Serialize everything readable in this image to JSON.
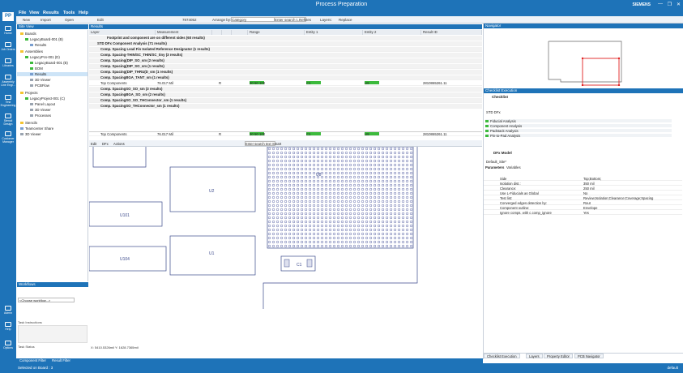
{
  "app": {
    "title": "Process Preparation",
    "brand": "SIEMENS",
    "logo": "PP",
    "window_controls": [
      "—",
      "❐",
      "✕"
    ]
  },
  "menu": [
    "File",
    "View",
    "Results",
    "Tools",
    "Help"
  ],
  "left_nav": [
    {
      "label": "Home",
      "icon": "home-icon"
    },
    {
      "label": "Job Orders",
      "icon": "job-orders-icon"
    },
    {
      "label": "Libraries",
      "icon": "libraries-icon"
    },
    {
      "label": "Assembly Line Engi...",
      "icon": "assembly-icon"
    },
    {
      "label": "Test Engineering",
      "icon": "test-icon"
    },
    {
      "label": "Stencil Design",
      "icon": "stencil-icon"
    },
    {
      "label": "Customer Manager",
      "icon": "customer-icon"
    },
    {
      "label": "Admin",
      "icon": "admin-icon"
    },
    {
      "label": "Help",
      "icon": "help-icon"
    },
    {
      "label": "Options",
      "icon": "options-icon"
    }
  ],
  "toolbar": {
    "new": "New",
    "import": "Import",
    "open": "Open",
    "edit": "Edit",
    "zoom": "7874052",
    "arrange_by": "Arrange by:",
    "arrange_value": "Category",
    "enter_search": "Enter search t...",
    "refdes": "RefDes",
    "layers": "Layers:",
    "layers_value": "Replace"
  },
  "site_view": {
    "title": "Site View",
    "items": [
      {
        "label": "Boards",
        "level": 0
      },
      {
        "label": "LegacyBoard-001 (B)",
        "level": 1
      },
      {
        "label": "Results",
        "level": 2
      },
      {
        "label": "Assemblies",
        "level": 0
      },
      {
        "label": "LegacyPcs-001 (D)",
        "level": 1
      },
      {
        "label": "LegacyBoard-001 (B)",
        "level": 2
      },
      {
        "label": "BOM",
        "level": 2
      },
      {
        "label": "Results",
        "level": 2,
        "selected": true
      },
      {
        "label": "3D Viewer",
        "level": 2
      },
      {
        "label": "PCBFlow",
        "level": 2
      },
      {
        "label": "Projects",
        "level": 0
      },
      {
        "label": "LegacyProject-001 (C)",
        "level": 1
      },
      {
        "label": "Panel Layout",
        "level": 2
      },
      {
        "label": "3D Viewer",
        "level": 2
      },
      {
        "label": "Processes",
        "level": 2
      },
      {
        "label": "Stencils",
        "level": 0
      },
      {
        "label": "Teamcenter Share",
        "level": 0
      },
      {
        "label": "3D Viewer",
        "level": 0
      }
    ]
  },
  "results": {
    "title": "Results",
    "columns": [
      "Layer",
      "Measurement",
      "",
      "",
      "",
      "Range",
      "Entity 1",
      "Entity 2",
      "Result ID"
    ],
    "rows": [
      {
        "type": "group",
        "text": "Footprint and component are on different sides (60 results)"
      },
      {
        "type": "group",
        "text": "STD DFx Component Analysis (71 results)"
      },
      {
        "type": "group",
        "text": "Comp. Spacing Lead Fin Isolated Reference Designator (1 results)"
      },
      {
        "type": "group",
        "text": "Comp. Spacing-THIN/SC_THIN/SC_tiny (3 results)"
      },
      {
        "type": "group",
        "text": "Comp. Spacing(DIP_SO_sm (2 results)"
      },
      {
        "type": "group",
        "text": "Comp. Spacing(DIP_SO_sm (1 results)"
      },
      {
        "type": "group",
        "text": "Comp. Spacing(DIP_THRU(D_sm (1 results)"
      },
      {
        "type": "group",
        "text": "Comp. SpacingBGA_TANT_sm (1 results)"
      },
      {
        "type": "row",
        "layer": "Top Components",
        "measurement": "76.017 Mil",
        "flag": "R",
        "range": "30 50 100",
        "e1": "C1",
        "e2": "U9",
        "id": "2810865261.11"
      },
      {
        "type": "group",
        "text": "Comp. SpacingSO_SO_sm (3 results)"
      },
      {
        "type": "group",
        "text": "Comp. SpacingBGA_SO_sm (2 results)"
      },
      {
        "type": "group",
        "text": "Comp. SpacingSO_SO_THConnector_sm (1 results)"
      },
      {
        "type": "group",
        "text": "Comp. SpacingSO_THConnector_sm (1 results)"
      }
    ],
    "footer": {
      "layer": "Top Components",
      "measurement": "76.017 Mil",
      "flag": "R",
      "range": "30 50 100",
      "e1": "C1",
      "e2": "U9",
      "id": "2810865261.11"
    }
  },
  "canvas_toolbar": {
    "edit": "Edit",
    "dfx": "DFx",
    "actions": "Actions",
    "search": "Enter search text",
    "smart": "Smart"
  },
  "canvas": {
    "components": [
      "U8",
      "U2",
      "U101",
      "U104",
      "U1",
      "C1"
    ],
    "pins": [
      "1",
      "2",
      "3",
      "4",
      "5",
      "6",
      "7",
      "8",
      "9",
      "10",
      "11",
      "12",
      "13",
      "14",
      "15",
      "16"
    ],
    "coords": "X: 5410.5326mil Y: 1628.7365mil"
  },
  "navigator": {
    "title": "Navigator"
  },
  "checklist": {
    "title": "Checklist Execution",
    "subtitle": "Checklist",
    "dfx": "STD DFx",
    "items": [
      "Fiducial Analysis",
      "Component Analysis",
      "Padstack Analysis",
      "Pin-to-Pad Analysis"
    ],
    "dfx_model": "DFx Model",
    "default_site": "Default_Site*",
    "tabs": [
      "Parameters",
      "Variables"
    ],
    "params": [
      {
        "k": "Side",
        "v": "Top;Bottom;"
      },
      {
        "k": "Isolation dist.:",
        "v": "350 mil"
      },
      {
        "k": "Clearance:",
        "v": "250 mil"
      },
      {
        "k": "Use L-Fiducials as Global",
        "v": "No"
      },
      {
        "k": "Test list:",
        "v": "Review;Isolation;Clearance;Coverage;Spacing"
      },
      {
        "k": "Converged edges detection by:",
        "v": "Rout"
      },
      {
        "k": "Component outline:",
        "v": "Envelope"
      },
      {
        "k": "Ignore comps. with c.comp_ignore",
        "v": "Yes"
      }
    ]
  },
  "right_tabs": [
    "Checklist Execution",
    "Layers",
    "Property Editor",
    "PCB Navigator"
  ],
  "workflows": {
    "title": "Workflows",
    "select": "<Choose workflow...>",
    "task_instructions": "Task Instructions",
    "task_status": "Task Status"
  },
  "bottom_tabs": [
    "Component Filter",
    "Result Filter"
  ],
  "status": {
    "left": "Selected on Board : 3",
    "right": "default"
  },
  "colors": {
    "brand": "#1e73b8",
    "green": "#3cba3c",
    "red": "#e02020",
    "canvas_line": "#3c4a8c"
  }
}
